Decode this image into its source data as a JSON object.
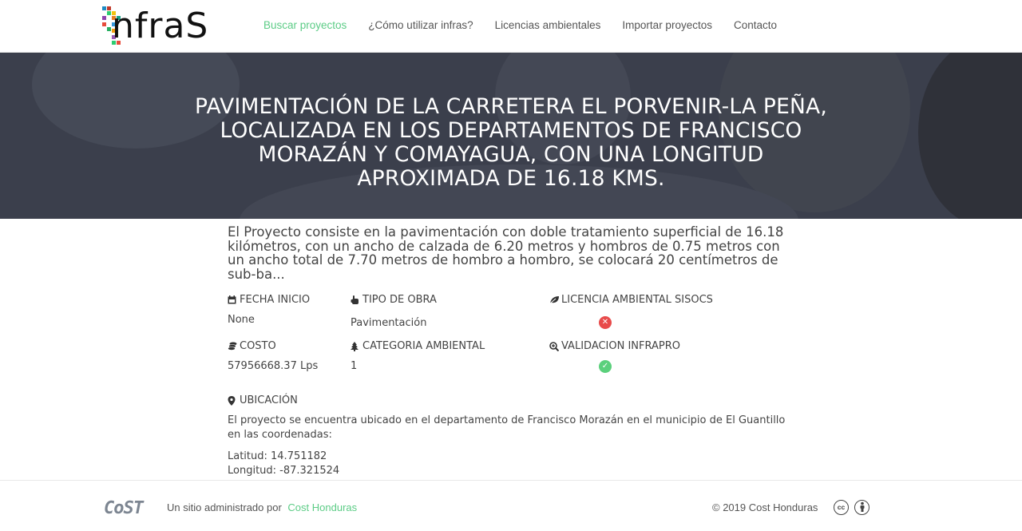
{
  "header": {
    "logo_text": "nfraS",
    "nav": [
      {
        "label": "Buscar proyectos",
        "active": true
      },
      {
        "label": "¿Cómo utilizar infras?",
        "active": false
      },
      {
        "label": "Licencias ambientales",
        "active": false
      },
      {
        "label": "Importar proyectos",
        "active": false
      },
      {
        "label": "Contacto",
        "active": false
      }
    ]
  },
  "hero": {
    "title": "PAVIMENTACIÓN DE LA CARRETERA EL PORVENIR-LA PEÑA, LOCALIZADA EN LOS DEPARTAMENTOS DE FRANCISCO MORAZÁN Y COMAYAGUA, CON UNA LONGITUD APROXIMADA DE 16.18 KMS."
  },
  "project": {
    "description": "El Proyecto consiste en la pavimentación con doble tratamiento superficial de 16.18 kilómetros, con un ancho de calzada de 6.20 metros y hombros de 0.75 metros con un ancho total de 7.70 metros de hombro a hombro, se colocará 20 centímetros de sub-ba...",
    "fields": {
      "fecha_inicio": {
        "label": "FECHA INICIO",
        "value": "None",
        "icon": "calendar-icon"
      },
      "tipo_obra": {
        "label": "TIPO DE OBRA",
        "value": "Pavimentación",
        "icon": "pointing-hand-icon"
      },
      "licencia": {
        "label": "LICENCIA AMBIENTAL SISOCS",
        "icon": "leaf-icon",
        "status": "no",
        "status_color": "#e84b4b"
      },
      "costo": {
        "label": "COSTO",
        "value": "57956668.37 Lps",
        "icon": "coins-icon"
      },
      "categoria": {
        "label": "CATEGORIA AMBIENTAL",
        "value": "1",
        "icon": "tree-icon"
      },
      "validacion": {
        "label": "VALIDACION INFRAPRO",
        "icon": "search-plus-icon",
        "status": "yes",
        "status_color": "#5bd07c"
      }
    },
    "ubicacion": {
      "label": "UBICACIÓN",
      "icon": "map-marker-icon",
      "text": "El proyecto se encuentra ubicado en el departamento de Francisco Morazán en el municipio de El Guantillo en las coordenadas:",
      "latitud": "Latitud: 14.751182",
      "longitud": "Longitud: -87.321524"
    }
  },
  "footer": {
    "cost_logo": "CoST",
    "admin_text": "Un sitio administrado por",
    "admin_link": "Cost Honduras",
    "copyright": "© 2019 Cost Honduras",
    "license_icons": [
      "creative-commons-icon",
      "attribution-icon"
    ]
  },
  "colors": {
    "accent": "#5ccc86",
    "hero_bg": "#3b3f4c",
    "status_no": "#e84b4b",
    "status_yes": "#5bd07c"
  }
}
